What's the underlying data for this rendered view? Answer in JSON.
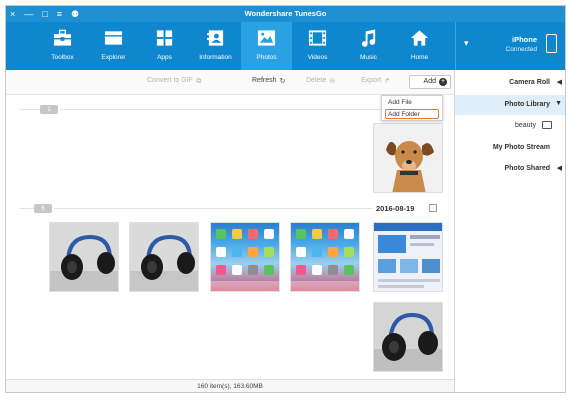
{
  "window": {
    "title": "Wondershare TunesGo",
    "controls": [
      "×",
      "—",
      "□",
      "≡",
      "⚉"
    ]
  },
  "nav": {
    "items": [
      {
        "label": "Home",
        "icon": "home-icon"
      },
      {
        "label": "Music",
        "icon": "music-icon"
      },
      {
        "label": "Videos",
        "icon": "video-icon"
      },
      {
        "label": "Photos",
        "icon": "photo-icon",
        "active": true
      },
      {
        "label": "Information",
        "icon": "contacts-icon"
      },
      {
        "label": "Apps",
        "icon": "apps-icon"
      },
      {
        "label": "Explorer",
        "icon": "folder-icon"
      },
      {
        "label": "Toolbox",
        "icon": "toolbox-icon"
      }
    ]
  },
  "device": {
    "name": "iPhone",
    "status": "Connected",
    "chevron": "▾"
  },
  "actions": {
    "add": "Add",
    "export": "Export",
    "delete": "Delete",
    "refresh": "Refresh",
    "convert": "Convert to GIF"
  },
  "add_menu": {
    "items": [
      "Add File",
      "Add Folder"
    ]
  },
  "sidebar": {
    "items": [
      {
        "label": "Camera Roll",
        "arrow": "◀"
      },
      {
        "label": "Photo Library",
        "arrow": "▼"
      },
      {
        "label": "beauty"
      },
      {
        "label": "My Photo Stream"
      },
      {
        "label": "Photo Shared",
        "arrow": "◀"
      }
    ]
  },
  "groups": [
    {
      "count": "1",
      "date": ""
    },
    {
      "count": "6",
      "date": "2016-08-19"
    }
  ],
  "status": {
    "text": "160 item(s), 163.60MB"
  },
  "colors": {
    "titlebar": "#1e8fd0",
    "toolbar": "#0f87cf",
    "active_nav": "#2aa1e3",
    "highlight": "#e87a2e",
    "sidebar_active": "#dfeef9"
  }
}
